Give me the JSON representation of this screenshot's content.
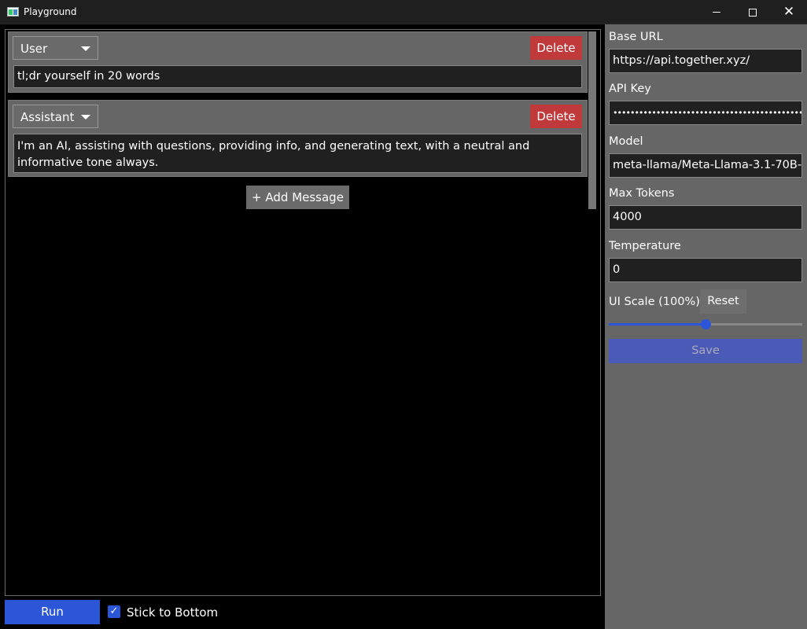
{
  "window": {
    "title": "Playground",
    "minimize_icon": "minimize-icon",
    "maximize_icon": "maximize-icon",
    "close_icon": "close-icon"
  },
  "messages": [
    {
      "role": "User",
      "delete_label": "Delete",
      "text": "tl;dr yourself in 20 words"
    },
    {
      "role": "Assistant",
      "delete_label": "Delete",
      "text": "I'm an AI, assisting with questions, providing info, and generating text, with a neutral and informative tone always."
    }
  ],
  "chat": {
    "add_message_label": "+ Add Message"
  },
  "footer": {
    "run_label": "Run",
    "stick_to_bottom_label": "Stick to Bottom",
    "stick_to_bottom_checked": true
  },
  "settings": {
    "base_url_label": "Base URL",
    "base_url_value": "https://api.together.xyz/",
    "api_key_label": "API Key",
    "api_key_value": "••••••••••••••••••••••••••••••••••••••••••••••",
    "model_label": "Model",
    "model_value": "meta-llama/Meta-Llama-3.1-70B-",
    "max_tokens_label": "Max Tokens",
    "max_tokens_value": "4000",
    "temperature_label": "Temperature",
    "temperature_value": "0",
    "ui_scale_label": "UI Scale (100%)",
    "reset_label": "Reset",
    "ui_scale_slider_fraction": 0.5,
    "save_label": "Save"
  },
  "colors": {
    "accent": "#2b56d8",
    "delete": "#c0393b",
    "panel": "#666666",
    "save_disabled": "#4b5ab6"
  }
}
